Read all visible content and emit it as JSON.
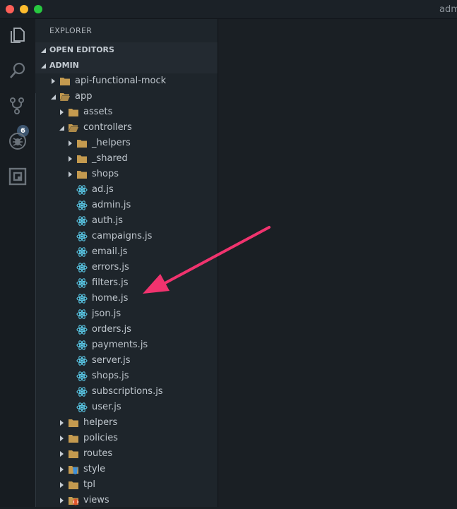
{
  "window": {
    "title": "adm"
  },
  "activity_bar": {
    "items": [
      {
        "name": "explorer-icon"
      },
      {
        "name": "search-icon"
      },
      {
        "name": "source-control-icon",
        "badge": "6"
      },
      {
        "name": "debug-icon"
      },
      {
        "name": "extensions-icon"
      }
    ]
  },
  "sidebar": {
    "title": "EXPLORER",
    "open_editors": "OPEN EDITORS",
    "workspace": "ADMIN",
    "tree": [
      {
        "label": "api-functional-mock",
        "type": "folder",
        "depth": 0,
        "expanded": false
      },
      {
        "label": "app",
        "type": "folder",
        "depth": 0,
        "expanded": true
      },
      {
        "label": "assets",
        "type": "folder",
        "depth": 1,
        "expanded": false
      },
      {
        "label": "controllers",
        "type": "folder",
        "depth": 1,
        "expanded": true
      },
      {
        "label": "_helpers",
        "type": "folder",
        "depth": 2,
        "expanded": false
      },
      {
        "label": "_shared",
        "type": "folder",
        "depth": 2,
        "expanded": false
      },
      {
        "label": "shops",
        "type": "folder",
        "depth": 2,
        "expanded": false
      },
      {
        "label": "ad.js",
        "type": "file",
        "depth": 2
      },
      {
        "label": "admin.js",
        "type": "file",
        "depth": 2
      },
      {
        "label": "auth.js",
        "type": "file",
        "depth": 2
      },
      {
        "label": "campaigns.js",
        "type": "file",
        "depth": 2
      },
      {
        "label": "email.js",
        "type": "file",
        "depth": 2
      },
      {
        "label": "errors.js",
        "type": "file",
        "depth": 2
      },
      {
        "label": "filters.js",
        "type": "file",
        "depth": 2
      },
      {
        "label": "home.js",
        "type": "file",
        "depth": 2
      },
      {
        "label": "json.js",
        "type": "file",
        "depth": 2
      },
      {
        "label": "orders.js",
        "type": "file",
        "depth": 2
      },
      {
        "label": "payments.js",
        "type": "file",
        "depth": 2
      },
      {
        "label": "server.js",
        "type": "file",
        "depth": 2
      },
      {
        "label": "shops.js",
        "type": "file",
        "depth": 2
      },
      {
        "label": "subscriptions.js",
        "type": "file",
        "depth": 2
      },
      {
        "label": "user.js",
        "type": "file",
        "depth": 2
      },
      {
        "label": "helpers",
        "type": "folder",
        "depth": 1,
        "expanded": false
      },
      {
        "label": "policies",
        "type": "folder",
        "depth": 1,
        "expanded": false
      },
      {
        "label": "routes",
        "type": "folder",
        "depth": 1,
        "expanded": false
      },
      {
        "label": "style",
        "type": "folder-style",
        "depth": 1,
        "expanded": false
      },
      {
        "label": "tpl",
        "type": "folder",
        "depth": 1,
        "expanded": false
      },
      {
        "label": "views",
        "type": "folder-views",
        "depth": 1,
        "expanded": false
      }
    ]
  },
  "colors": {
    "folder": "#c49a4f",
    "react": "#5ed3f3",
    "arrow": "#f0336e",
    "style_icon": "#3f8fd6",
    "views_icon": "#e0552b"
  }
}
